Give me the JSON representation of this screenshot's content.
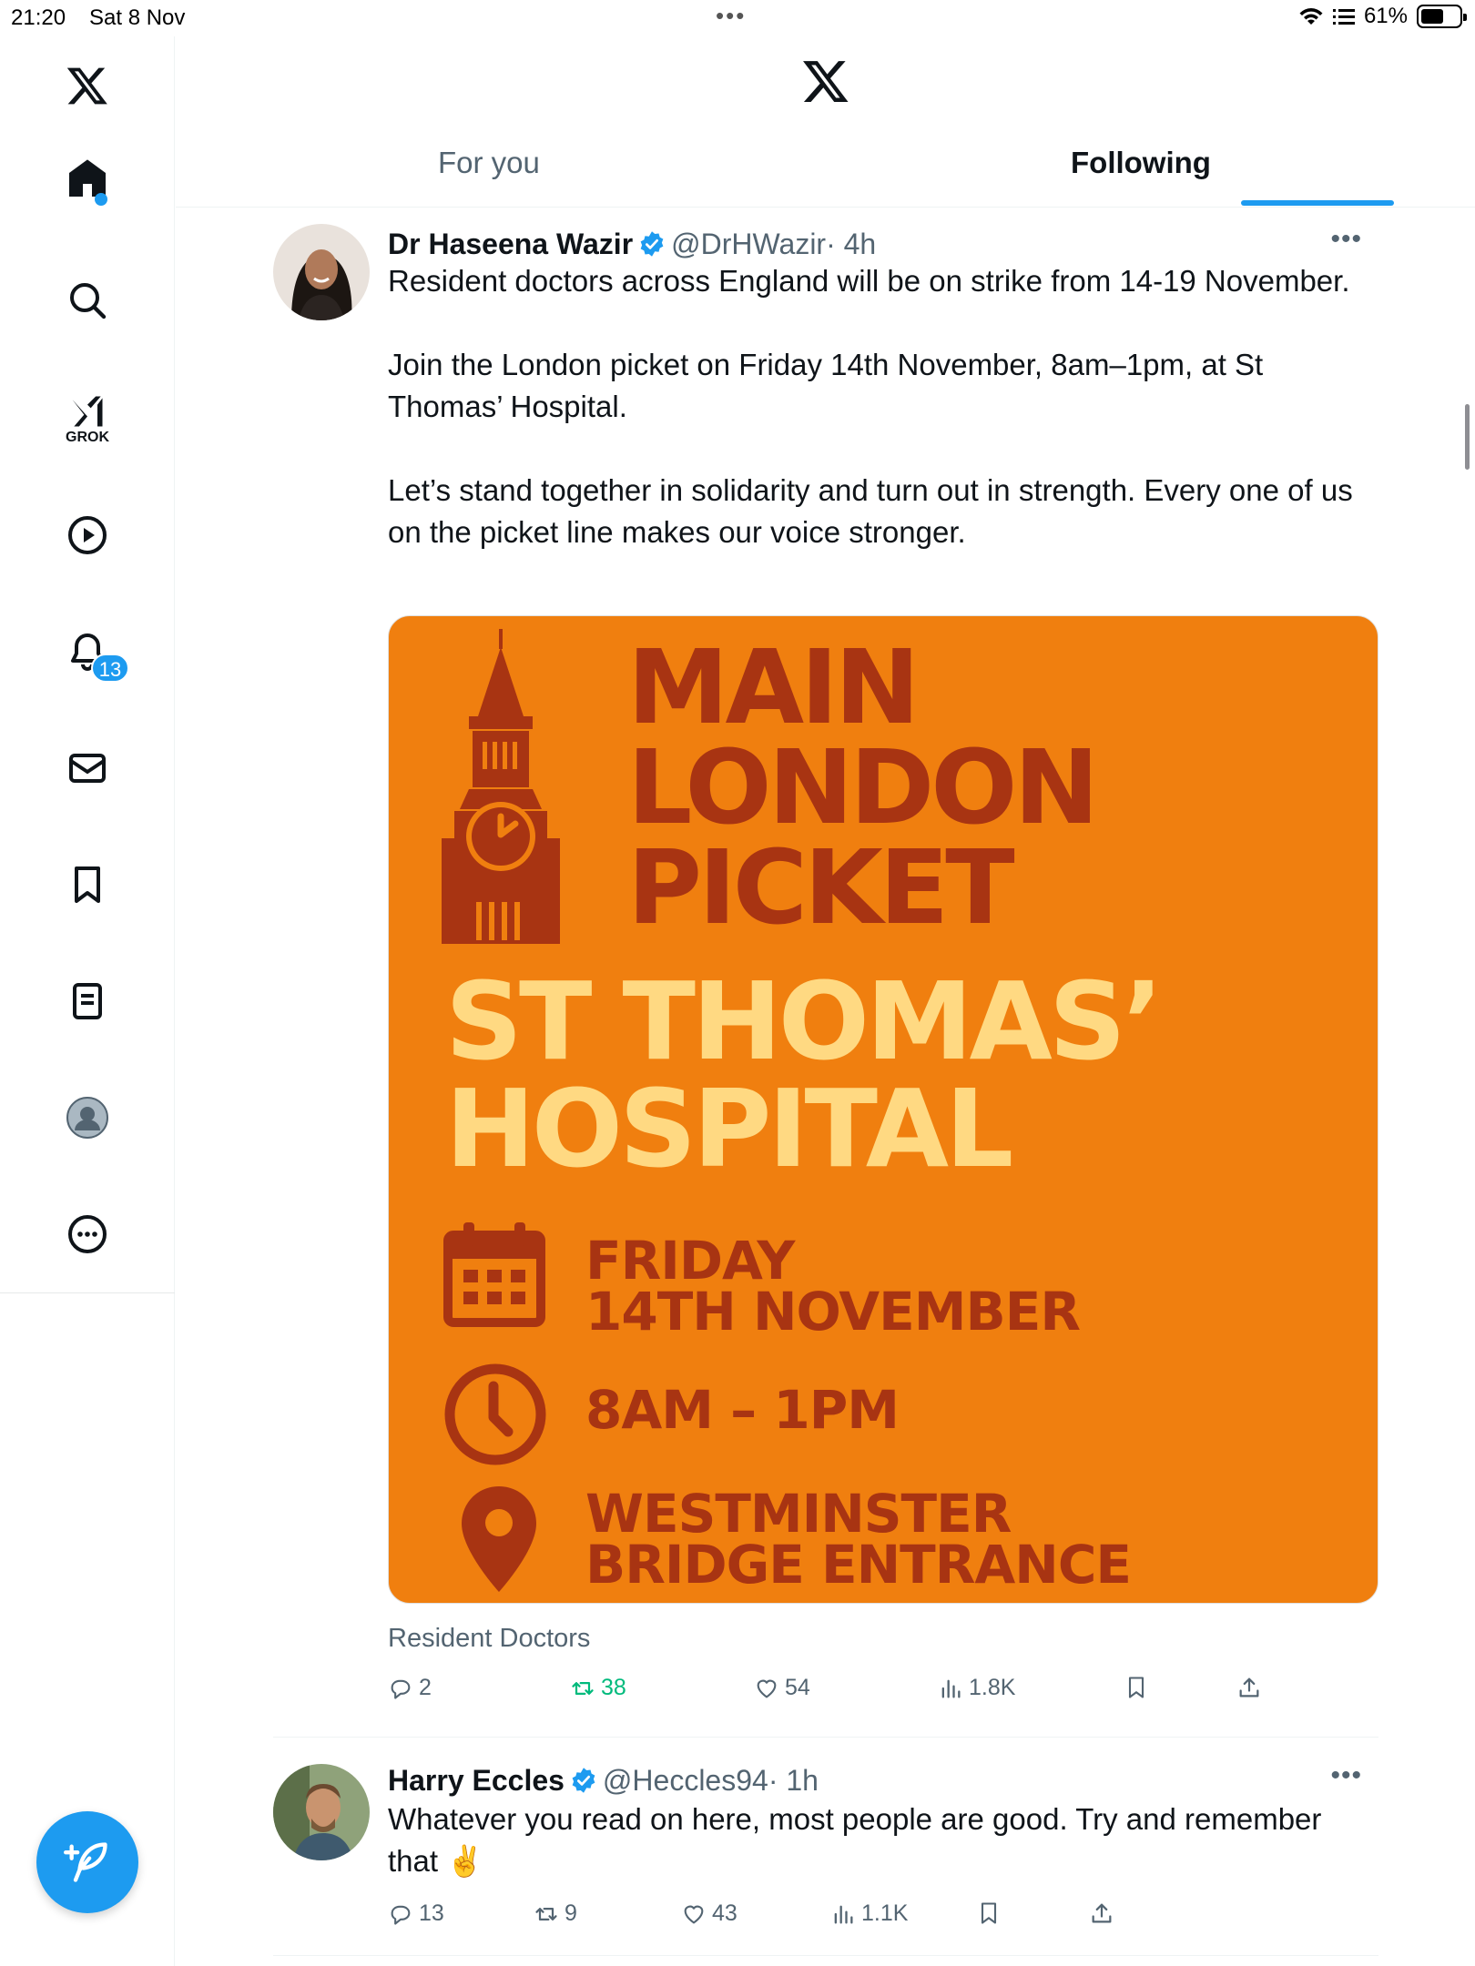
{
  "status_bar": {
    "time": "21:20",
    "date": "Sat 8 Nov",
    "battery": "61%",
    "battery_level": 0.61
  },
  "sidebar": {
    "items": [
      {
        "name": "home",
        "label": "Home"
      },
      {
        "name": "search",
        "label": "Explore"
      },
      {
        "name": "grok",
        "label": "GROK"
      },
      {
        "name": "video",
        "label": "Video"
      },
      {
        "name": "notifications",
        "label": "Notifications",
        "badge": "13"
      },
      {
        "name": "messages",
        "label": "Messages"
      },
      {
        "name": "bookmarks",
        "label": "Bookmarks"
      },
      {
        "name": "lists",
        "label": "Lists"
      },
      {
        "name": "profile",
        "label": "Profile"
      },
      {
        "name": "more",
        "label": "More"
      }
    ]
  },
  "header": {
    "tabs": [
      "For you",
      "Following"
    ],
    "active_tab": "Following"
  },
  "posts": [
    {
      "name": "Dr Haseena Wazir",
      "handle": "@DrHWazir",
      "time": "· 4h",
      "paragraphs": [
        "Resident doctors across England will be on strike from 14-19 November.",
        "Join the London picket on Friday 14th November, 8am–1pm, at St Thomas’ Hospital.",
        "Let’s stand together in solidarity and turn out in strength. Every one of us on the picket line makes our voice stronger."
      ],
      "media": {
        "title": [
          "MAIN",
          "LONDON",
          "PICKET"
        ],
        "hospital": [
          "ST THOMAS’",
          "HOSPITAL"
        ],
        "date_lines": [
          "FRIDAY",
          "14TH NOVEMBER"
        ],
        "time_text": "8AM – 1PM",
        "location_lines": [
          "WESTMINSTER",
          "BRIDGE ENTRANCE"
        ],
        "colors": {
          "background": "#f07f0f",
          "dark": "#a83412",
          "light": "#ffd982"
        }
      },
      "caption": "Resident Doctors",
      "stats": {
        "replies": "2",
        "reposts": "38",
        "likes": "54",
        "views": "1.8K"
      }
    },
    {
      "name": "Harry Eccles",
      "handle": "@Heccles94",
      "time": "· 1h",
      "text": "Whatever you read on here, most people are good. Try and remember that ✌️",
      "stats": {
        "replies": "13",
        "reposts": "9",
        "likes": "43",
        "views": "1.1K"
      }
    }
  ],
  "colors": {
    "accent": "#1d9bf0",
    "secondary_text": "#536471",
    "repost_active": "#00ba7c"
  }
}
